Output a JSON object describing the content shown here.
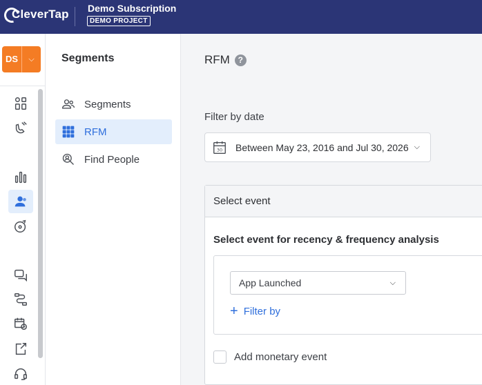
{
  "header": {
    "brand": "CleverTap",
    "project_name": "Demo Subscription",
    "project_badge": "DEMO PROJECT"
  },
  "account": {
    "initials": "DS"
  },
  "rail": {
    "icons": [
      "grid-icon",
      "magnet-icon",
      "bar-chart-icon",
      "users-icon",
      "target-icon",
      "chat-icon",
      "flow-icon",
      "schedule-icon",
      "export-icon",
      "headset-icon"
    ],
    "active": "users-icon"
  },
  "panel": {
    "title": "Segments",
    "items": [
      {
        "label": "Segments",
        "icon": "users-outline-icon"
      },
      {
        "label": "RFM",
        "icon": "rfm-grid-icon",
        "active": true
      },
      {
        "label": "Find People",
        "icon": "find-people-icon"
      }
    ]
  },
  "main": {
    "title": "RFM",
    "help": "?",
    "filter_label": "Filter by date",
    "date_range": "Between May 23, 2016 and Jul 30, 2026",
    "card": {
      "header": "Select event",
      "subtitle": "Select event for recency & frequency analysis",
      "event_value": "App Launched",
      "filter_by": "Filter by",
      "monetary_label": "Add monetary event"
    }
  },
  "colors": {
    "topbar": "#2b3576",
    "accent_orange": "#f47c24",
    "accent_blue": "#2f6fdc",
    "active_bg": "#e3eefc"
  }
}
